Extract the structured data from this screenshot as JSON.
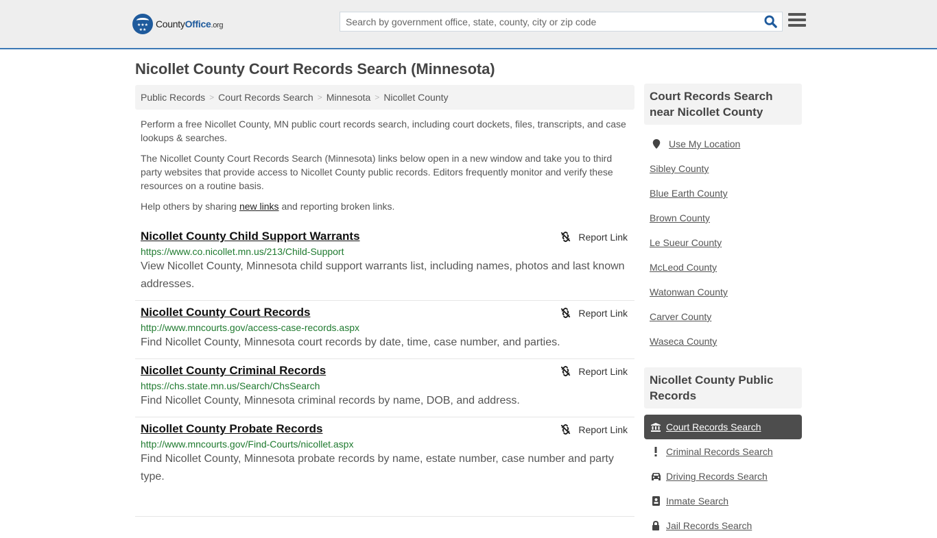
{
  "header": {
    "logo": {
      "brand_county": "County",
      "brand_office": "Office",
      "brand_tld": ".org"
    },
    "search": {
      "placeholder": "Search by government office, state, county, city or zip code",
      "value": ""
    },
    "icons": {
      "search": "search-icon",
      "menu": "hamburger-menu-icon"
    }
  },
  "page": {
    "title": "Nicollet County Court Records Search (Minnesota)"
  },
  "breadcrumb": [
    {
      "label": "Public Records"
    },
    {
      "label": "Court Records Search"
    },
    {
      "label": "Minnesota"
    },
    {
      "label": "Nicollet County"
    }
  ],
  "intro": {
    "p1": "Perform a free Nicollet County, MN public court records search, including court dockets, files, transcripts, and case lookups & searches.",
    "p2": "The Nicollet County Court Records Search (Minnesota) links below open in a new window and take you to third party websites that provide access to Nicollet County public records. Editors frequently monitor and verify these resources on a routine basis.",
    "p3_before": "Help others by sharing ",
    "p3_link": "new links",
    "p3_after": " and reporting broken links."
  },
  "results": [
    {
      "title": "Nicollet County Child Support Warrants",
      "url": "https://www.co.nicollet.mn.us/213/Child-Support",
      "description": "View Nicollet County, Minnesota child support warrants list, including names, photos and last known addresses.",
      "report_label": "Report Link"
    },
    {
      "title": "Nicollet County Court Records",
      "url": "http://www.mncourts.gov/access-case-records.aspx",
      "description": "Find Nicollet County, Minnesota court records by date, time, case number, and parties.",
      "report_label": "Report Link"
    },
    {
      "title": "Nicollet County Criminal Records",
      "url": "https://chs.state.mn.us/Search/ChsSearch",
      "description": "Find Nicollet County, Minnesota criminal records by name, DOB, and address.",
      "report_label": "Report Link"
    },
    {
      "title": "Nicollet County Probate Records",
      "url": "http://www.mncourts.gov/Find-Courts/nicollet.aspx",
      "description": "Find Nicollet County, Minnesota probate records by name, estate number, case number and party type.",
      "report_label": "Report Link"
    }
  ],
  "sidebar": {
    "near": {
      "heading": "Court Records Search near Nicollet County",
      "use_location": "Use My Location",
      "counties": [
        "Sibley County",
        "Blue Earth County",
        "Brown County",
        "Le Sueur County",
        "McLeod County",
        "Watonwan County",
        "Carver County",
        "Waseca County"
      ]
    },
    "public_records": {
      "heading": "Nicollet County Public Records",
      "items": [
        {
          "label": "Court Records Search",
          "icon": "courthouse-icon",
          "active": true
        },
        {
          "label": "Criminal Records Search",
          "icon": "exclamation-icon",
          "active": false
        },
        {
          "label": "Driving Records Search",
          "icon": "car-icon",
          "active": false
        },
        {
          "label": "Inmate Search",
          "icon": "id-badge-icon",
          "active": false
        },
        {
          "label": "Jail Records Search",
          "icon": "lock-icon",
          "active": false
        }
      ]
    }
  },
  "colors": {
    "brand_blue": "#1e5a9c",
    "header_border": "#3b78b5",
    "url_green": "#1f7a2f",
    "active_item_bg": "#4d4d4d"
  }
}
